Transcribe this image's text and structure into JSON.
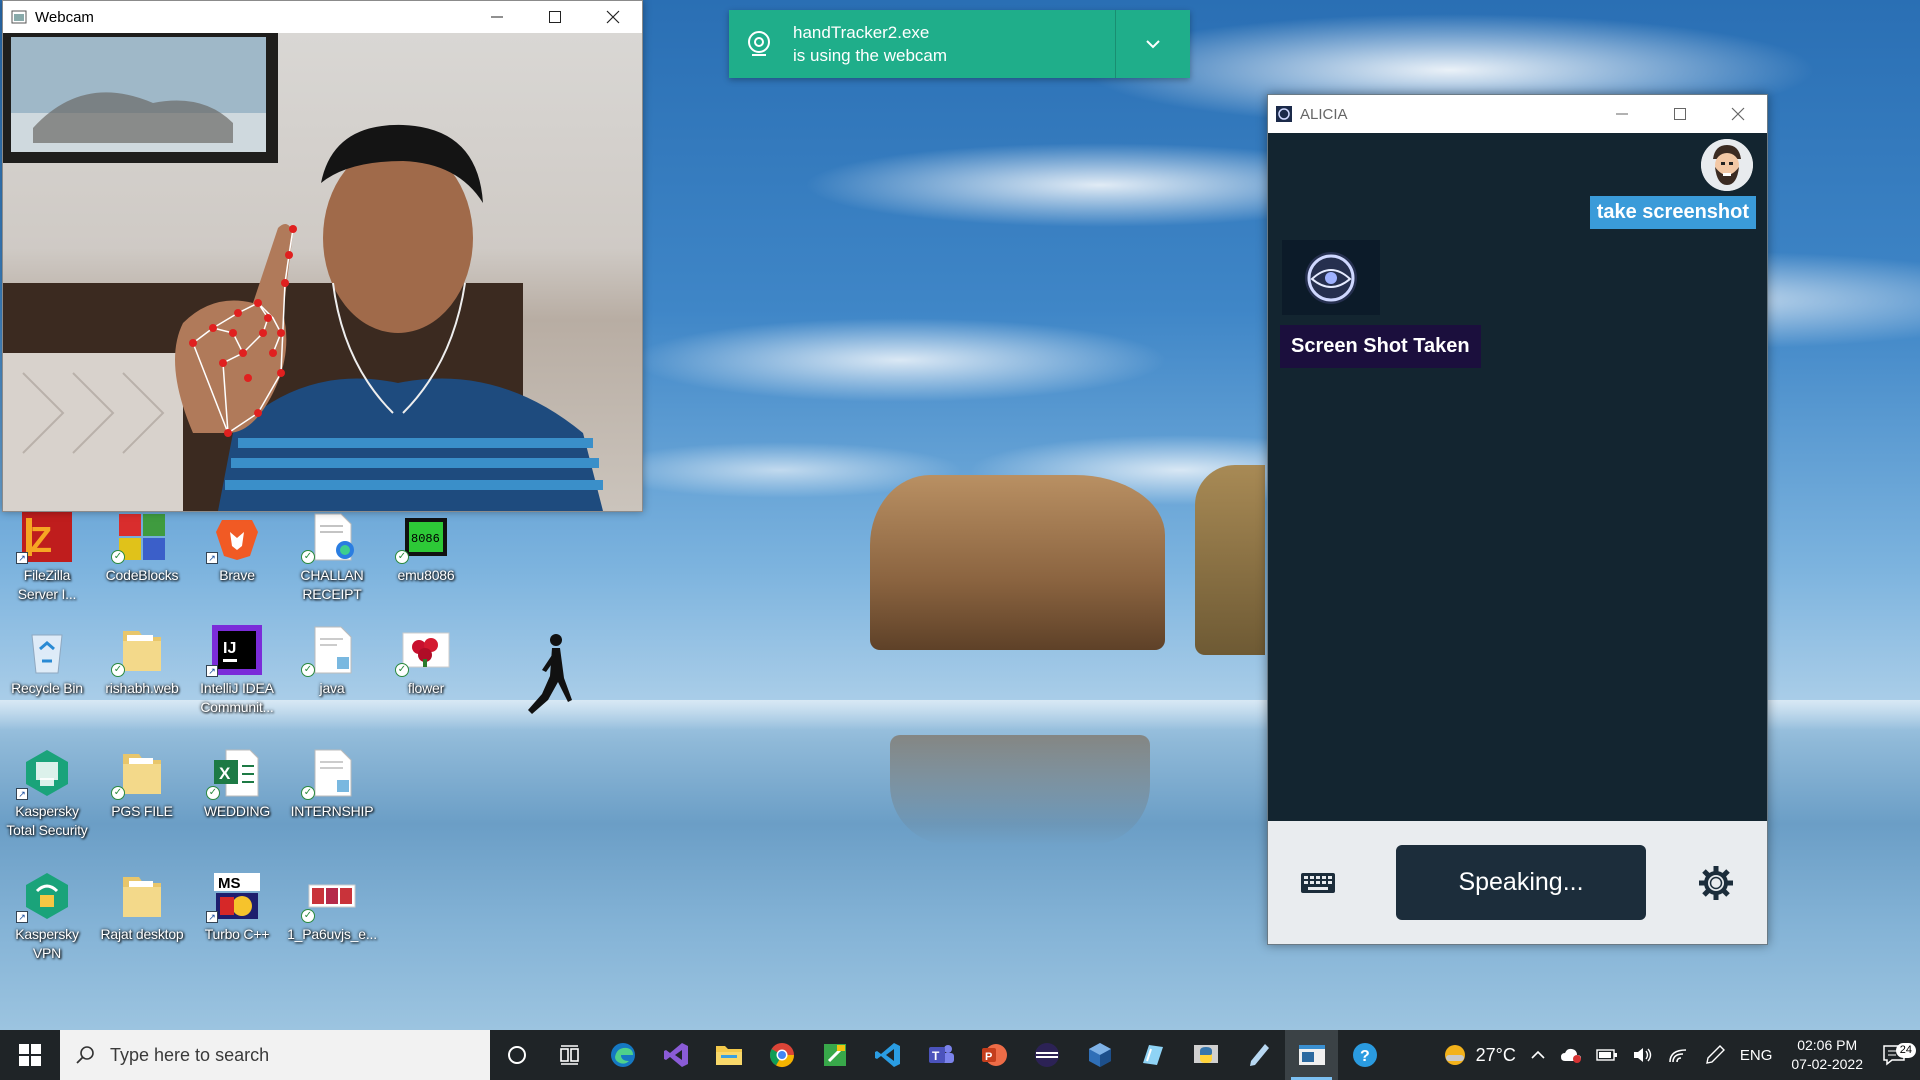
{
  "webcam": {
    "title": "Webcam"
  },
  "toast": {
    "line1": "handTracker2.exe",
    "line2": "is using the webcam"
  },
  "alicia": {
    "title": "ALICIA",
    "user_message": "take screenshot",
    "bot_message": "Screen Shot Taken",
    "speak_label": "Speaking..."
  },
  "desktop_icons": [
    {
      "label": "FileZilla Server I...",
      "icon": "filezilla-icon"
    },
    {
      "label": "CodeBlocks",
      "icon": "codeblocks-icon"
    },
    {
      "label": "Brave",
      "icon": "brave-icon"
    },
    {
      "label": "CHALLAN RECEIPT",
      "icon": "document-icon"
    },
    {
      "label": "emu8086",
      "icon": "chip-icon"
    },
    {
      "label": "Recycle Bin",
      "icon": "recycle-bin-icon"
    },
    {
      "label": "rishabh.web",
      "icon": "folder-icon"
    },
    {
      "label": "IntelliJ IDEA Communit...",
      "icon": "intellij-icon"
    },
    {
      "label": "java",
      "icon": "document-icon"
    },
    {
      "label": "flower",
      "icon": "image-icon"
    },
    {
      "label": "Kaspersky Total Security",
      "icon": "kaspersky-icon"
    },
    {
      "label": "PGS FILE",
      "icon": "folder-icon"
    },
    {
      "label": "WEDDING",
      "icon": "excel-icon"
    },
    {
      "label": "INTERNSHIP",
      "icon": "document-icon"
    },
    {
      "label": "Kaspersky VPN",
      "icon": "vpn-icon"
    },
    {
      "label": "Rajat desktop",
      "icon": "folder-icon"
    },
    {
      "label": "Turbo C++",
      "icon": "turbo-cpp-icon"
    },
    {
      "label": "1_Pa6uvjs_e...",
      "icon": "image-icon"
    }
  ],
  "taskbar": {
    "search_placeholder": "Type here to search",
    "temperature": "27°C",
    "language": "ENG",
    "time": "02:06 PM",
    "date": "07-02-2022",
    "notification_count": "24"
  },
  "colors": {
    "toast": "#1fae8a",
    "alicia_bg": "#132530",
    "user_bubble": "#3a9bd9",
    "bot_bubble": "#1b0f3d",
    "taskbar": "#1f2427"
  }
}
